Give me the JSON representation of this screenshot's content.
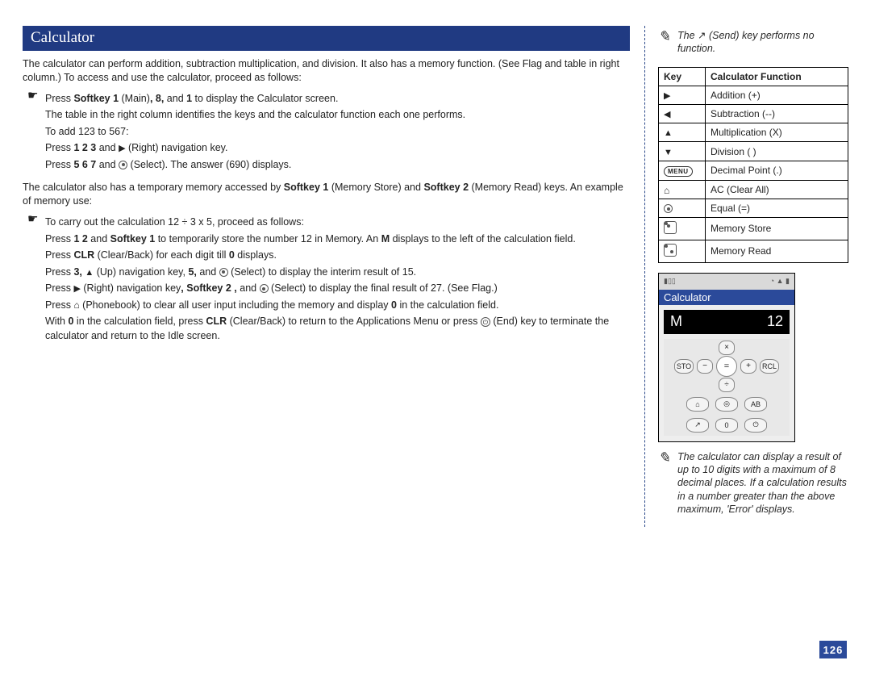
{
  "header": {
    "title": "Calculator"
  },
  "intro": "The calculator can perform addition, subtraction multiplication, and division. It also has a memory function. (See Flag and table in right column.) To access and use the calculator, proceed as follows:",
  "bullet1": {
    "line1_pre": "Press ",
    "line1_b1": "Softkey 1",
    "line1_mid1": " (Main)",
    "line1_b2": ", 8,",
    "line1_mid2": " and ",
    "line1_b3": "1",
    "line1_post": " to display the Calculator screen.",
    "line2": "The table in the right column identifies the keys and the calculator function each one performs.",
    "line3": "To add 123 to 567:",
    "line4_pre": "Press ",
    "line4_b": "1 2 3",
    "line4_mid": " and ",
    "line4_post": " (Right) navigation key.",
    "line5_pre": "Press ",
    "line5_b": "5 6 7",
    "line5_mid": " and ",
    "line5_post": " (Select). The answer (690) displays."
  },
  "mid_para_pre": "The calculator also has a temporary memory accessed by ",
  "mid_para_b1": "Softkey 1",
  "mid_para_mid1": " (Memory Store) and ",
  "mid_para_b2": "Softkey 2",
  "mid_para_post": " (Memory Read) keys. An example of memory use:",
  "bullet2": {
    "line1": "To carry out the calculation 12 ÷ 3 x 5, proceed as follows:",
    "line2_pre": "Press ",
    "line2_b1": "1 2",
    "line2_mid1": " and ",
    "line2_b2": "Softkey 1",
    "line2_mid2": " to temporarily store the number 12 in Memory. An ",
    "line2_b3": "M",
    "line2_post": " displays to the left of the calculation field.",
    "line3_pre": "Press ",
    "line3_b": "CLR",
    "line3_mid": " (Clear/Back) for each digit till ",
    "line3_b2": "0",
    "line3_post": " displays.",
    "line4_pre": "Press ",
    "line4_b1": "3,",
    "line4_mid1": " ",
    "line4_mid2": " (Up) navigation key, ",
    "line4_b2": "5,",
    "line4_mid3": " and ",
    "line4_post": " (Select) to display the interim result of 15.",
    "line5_pre": "Press ",
    "line5_mid1": " (Right) navigation key",
    "line5_b1": ", Softkey 2 ,",
    "line5_mid2": " and ",
    "line5_post": " (Select) to display the final result of 27. (See Flag.)",
    "line6_pre": "Press ",
    "line6_mid": " (Phonebook) to clear all user input including the memory and display ",
    "line6_b": "0",
    "line6_post": " in the calculation field.",
    "line7_pre": "With ",
    "line7_b1": "0",
    "line7_mid1": " in the calculation field, press ",
    "line7_b2": "CLR",
    "line7_mid2": " (Clear/Back) to return to the Applications Menu or press ",
    "line7_post": " (End) key to terminate the calculator and return to the Idle screen."
  },
  "note1_pre": "The ",
  "note1_post": " (Send) key performs no function.",
  "table": {
    "h1": "Key",
    "h2": "Calculator Function",
    "rows": [
      {
        "func": "Addition (+)"
      },
      {
        "func": "Subtraction (--)"
      },
      {
        "func": "Multiplication (X)"
      },
      {
        "func": "Division ( )"
      },
      {
        "menu": "MENU",
        "func": "Decimal Point (.)"
      },
      {
        "func": "AC (Clear All)"
      },
      {
        "func": "Equal (=)"
      },
      {
        "func": "Memory Store"
      },
      {
        "func": "Memory Read"
      }
    ]
  },
  "phone": {
    "title": "Calculator",
    "disp_left": "M",
    "disp_right": "12",
    "nav_center": "=",
    "nav_up": "×",
    "nav_down": "÷",
    "nav_left": "−",
    "nav_right": "+",
    "sk_left": "STO",
    "sk_right": "RCL",
    "btn_book": "⌂",
    "btn_sel": "◎",
    "btn_ab": "AB",
    "btn_send": "↗",
    "btn_0": "0",
    "btn_end": "⏻"
  },
  "note2": "The calculator can display a result of up to 10 digits with a maximum of 8 decimal places. If a calculation results in a number greater than the above maximum, 'Error' displays.",
  "page_number": "126"
}
